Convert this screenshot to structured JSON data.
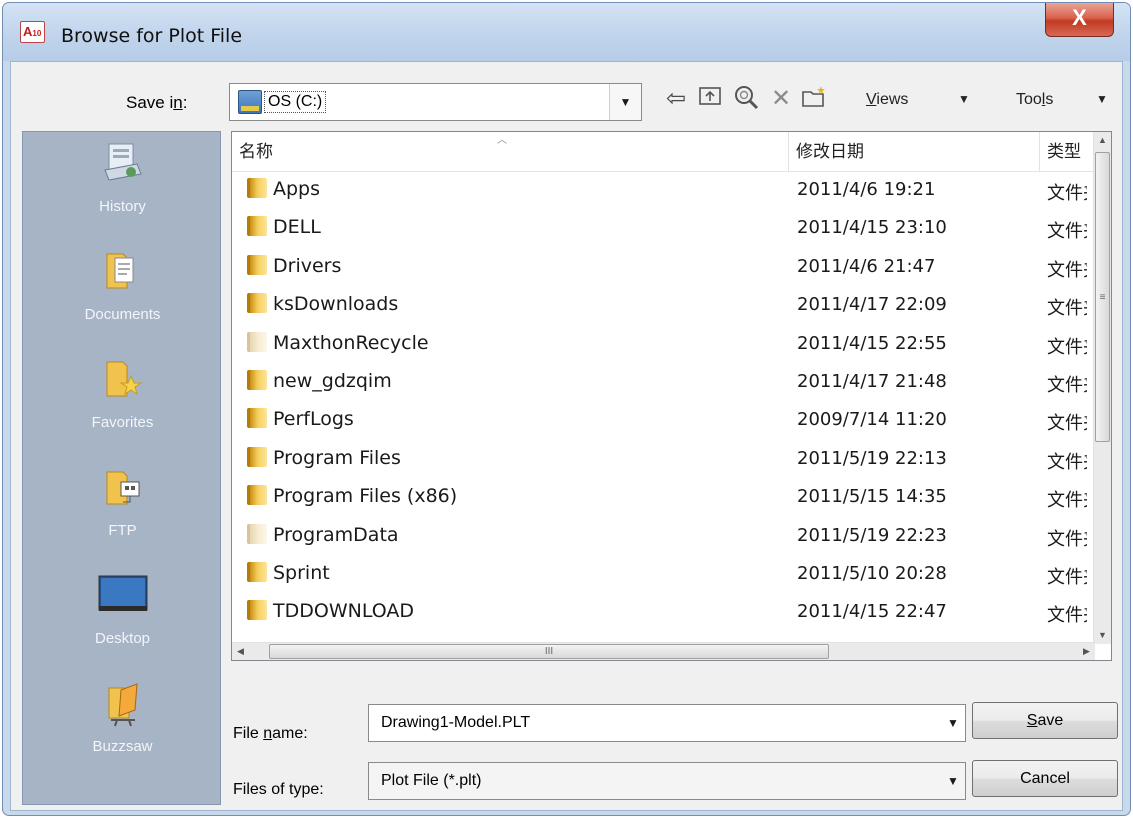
{
  "window": {
    "title": "Browse for Plot File",
    "app_icon_text": "A",
    "app_icon_sub": "10",
    "close_label": "X"
  },
  "toolbar": {
    "save_in_prefix": "Save i",
    "save_in_underlined": "n",
    "save_in_suffix": ":",
    "location": "OS (C:)",
    "icons": [
      "back-icon",
      "up-folder-icon",
      "search-web-icon",
      "delete-icon",
      "new-folder-icon"
    ],
    "views_label": "Views",
    "views_underlined": "V",
    "views_rest": "iews",
    "tools_label": "Tools",
    "tools_prefix": "Too",
    "tools_underlined": "l",
    "tools_rest": "s"
  },
  "places": [
    {
      "label": "History",
      "icon": "history-icon"
    },
    {
      "label": "Documents",
      "icon": "documents-icon"
    },
    {
      "label": "Favorites",
      "icon": "favorites-icon"
    },
    {
      "label": "FTP",
      "icon": "ftp-icon"
    },
    {
      "label": "Desktop",
      "icon": "desktop-icon"
    },
    {
      "label": "Buzzsaw",
      "icon": "buzzsaw-icon"
    }
  ],
  "file_list": {
    "columns": {
      "name": "名称",
      "modified": "修改日期",
      "type": "类型"
    },
    "rows": [
      {
        "name": "Apps",
        "modified": "2011/4/6 19:21",
        "type": "文件夹",
        "pale": false
      },
      {
        "name": "DELL",
        "modified": "2011/4/15 23:10",
        "type": "文件夹",
        "pale": false
      },
      {
        "name": "Drivers",
        "modified": "2011/4/6 21:47",
        "type": "文件夹",
        "pale": false
      },
      {
        "name": "ksDownloads",
        "modified": "2011/4/17 22:09",
        "type": "文件夹",
        "pale": false
      },
      {
        "name": "MaxthonRecycle",
        "modified": "2011/4/15 22:55",
        "type": "文件夹",
        "pale": true
      },
      {
        "name": "new_gdzqim",
        "modified": "2011/4/17 21:48",
        "type": "文件夹",
        "pale": false
      },
      {
        "name": "PerfLogs",
        "modified": "2009/7/14 11:20",
        "type": "文件夹",
        "pale": false
      },
      {
        "name": "Program Files",
        "modified": "2011/5/19 22:13",
        "type": "文件夹",
        "pale": false
      },
      {
        "name": "Program Files (x86)",
        "modified": "2011/5/15 14:35",
        "type": "文件夹",
        "pale": false
      },
      {
        "name": "ProgramData",
        "modified": "2011/5/19 22:23",
        "type": "文件夹",
        "pale": true
      },
      {
        "name": "Sprint",
        "modified": "2011/5/10 20:28",
        "type": "文件夹",
        "pale": false
      },
      {
        "name": "TDDOWNLOAD",
        "modified": "2011/4/15 22:47",
        "type": "文件夹",
        "pale": false
      }
    ]
  },
  "file_name": {
    "label_prefix": "File ",
    "label_underlined": "n",
    "label_suffix": "ame:",
    "value": "Drawing1-Model.PLT"
  },
  "file_type": {
    "label": "Files of type:",
    "value": "Plot File (*.plt)"
  },
  "buttons": {
    "save_underlined": "S",
    "save_rest": "ave",
    "cancel": "Cancel"
  }
}
